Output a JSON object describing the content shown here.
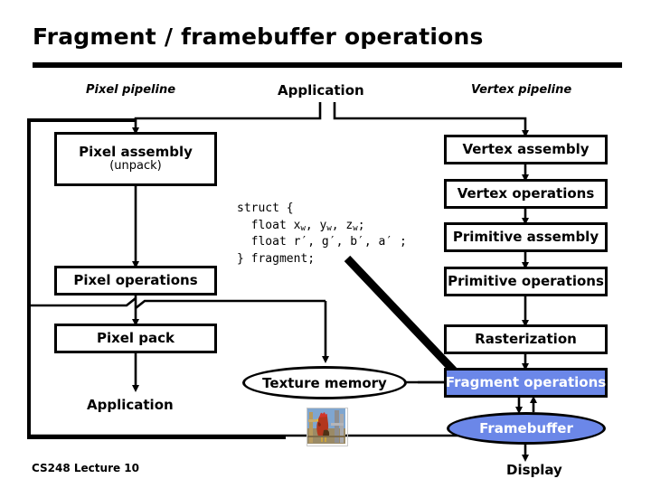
{
  "slide": {
    "title": "Fragment / framebuffer operations",
    "footer": "CS248 Lecture 10",
    "accent_color": "#6B87E8",
    "line_color": "#000000",
    "background": "#ffffff"
  },
  "columns": {
    "pixel_pipeline": "Pixel pipeline",
    "application": "Application",
    "vertex_pipeline": "Vertex pipeline"
  },
  "pixel_pipeline": {
    "pixel_assembly": "Pixel assembly",
    "pixel_assembly_sub": "(unpack)",
    "pixel_operations": "Pixel operations",
    "pixel_pack": "Pixel pack",
    "application_out": "Application"
  },
  "vertex_pipeline": {
    "vertex_assembly": "Vertex assembly",
    "vertex_operations": "Vertex operations",
    "primitive_assembly": "Primitive assembly",
    "primitive_operations": "Primitive operations",
    "rasterization": "Rasterization",
    "fragment_operations": "Fragment operations",
    "framebuffer": "Framebuffer",
    "display": "Display"
  },
  "shared": {
    "texture_memory": "Texture memory",
    "texture_thumbnail_alt": "rooster-photo"
  },
  "code": {
    "line1": "struct {",
    "line2_prefix": "  float x",
    "line2_sub1": "w",
    "line2_mid1": ", y",
    "line2_sub2": "w",
    "line2_mid2": ", z",
    "line2_sub3": "w",
    "line2_suffix": ";",
    "line3": "  float r′, g′, b′, a′ ;",
    "line4": "} fragment;"
  },
  "icons": {
    "arrow_down": "arrow-down-icon",
    "arrow_up": "arrow-up-icon",
    "arrow_right": "arrow-right-icon",
    "thick_diagonal_arrow": "thick-diagonal-arrow-icon"
  }
}
